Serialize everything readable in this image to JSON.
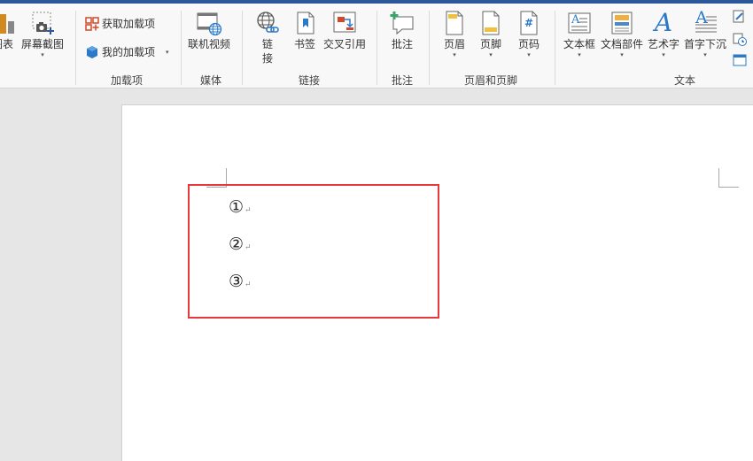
{
  "ribbon": {
    "partial_left_label": "图表",
    "groups": {
      "addins": {
        "label": "加载项",
        "get_addins": "获取加载项",
        "my_addins": "我的加载项"
      },
      "media": {
        "label": "媒体",
        "online_video": "联机视频"
      },
      "links": {
        "label": "链接",
        "link_line1": "链",
        "link_line2": "接",
        "bookmark": "书签",
        "cross_reference": "交叉引用"
      },
      "comments": {
        "label": "批注",
        "comment": "批注"
      },
      "header_footer": {
        "label": "页眉和页脚",
        "header": "页眉",
        "footer": "页脚",
        "page_number": "页码"
      },
      "text": {
        "label": "文本",
        "text_box": "文本框",
        "quick_parts": "文档部件",
        "wordart": "艺术字",
        "drop_cap": "首字下沉"
      }
    },
    "screenshot": "屏幕截图",
    "caret": "▾",
    "page_number_symbol": "#",
    "wordart_symbol": "A",
    "textbox_symbol": "A"
  },
  "document": {
    "list_items": [
      "①",
      "②",
      "③"
    ],
    "paragraph_mark": "↵"
  },
  "colors": {
    "accent": "#2b579a",
    "highlight_border": "#e8383b",
    "comment_green": "#3aa56a"
  }
}
